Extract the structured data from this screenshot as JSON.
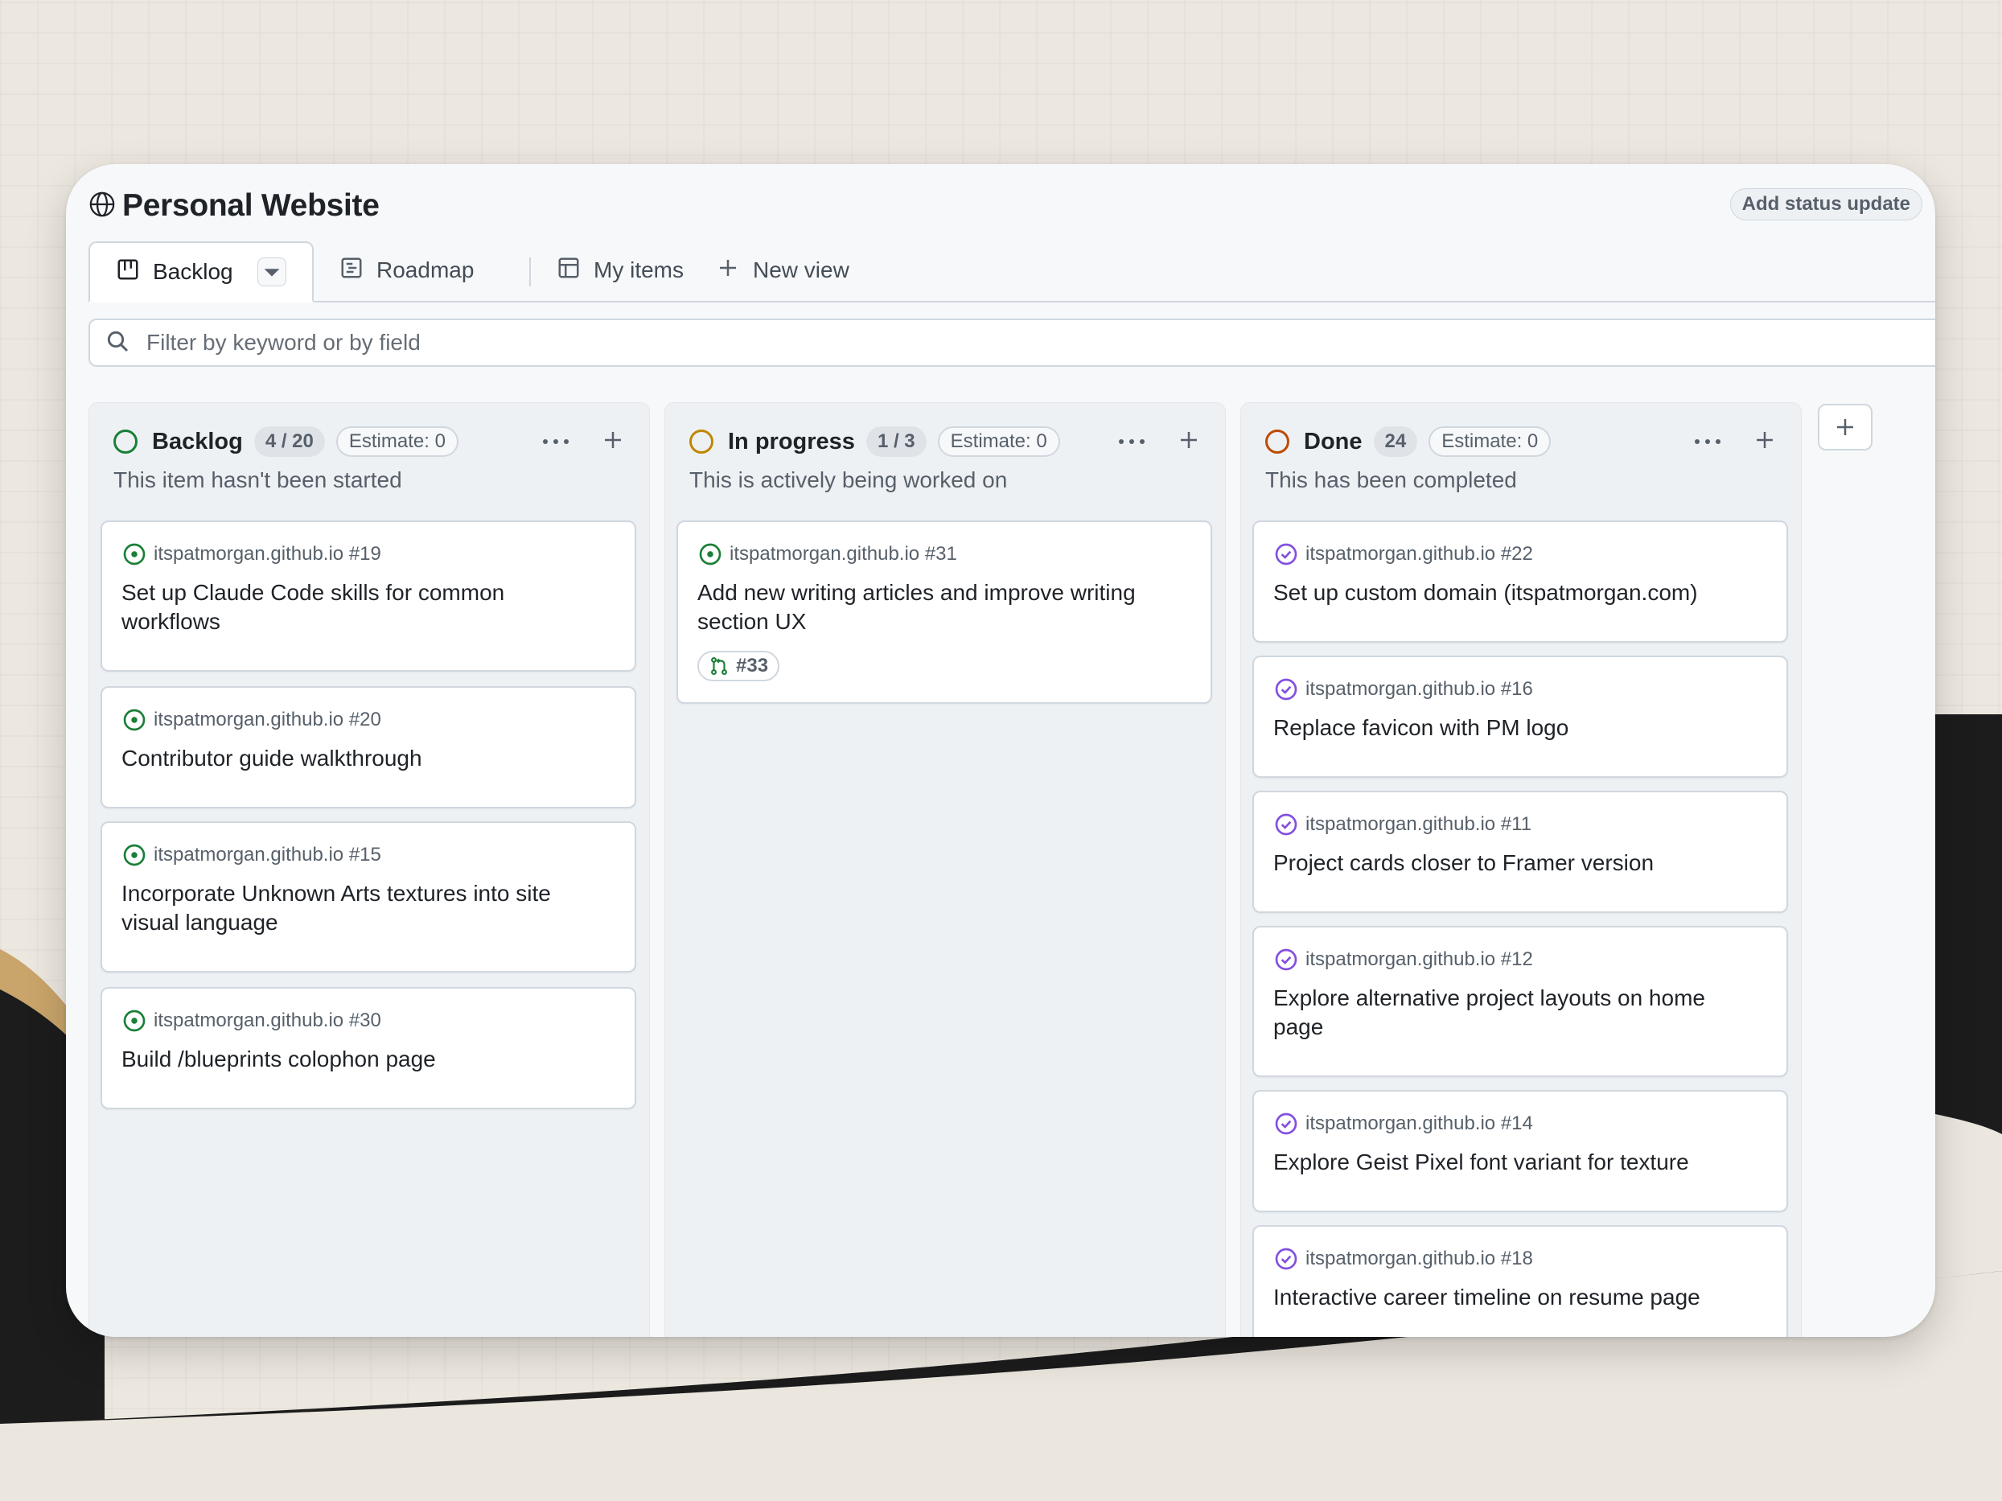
{
  "colors": {
    "open_green": "#1a7f37",
    "done_purple": "#8250df",
    "progress_yellow": "#bf8700",
    "done_column_orange": "#bc4c00",
    "text_primary": "#1f2328",
    "text_muted": "#57606a"
  },
  "header": {
    "title": "Personal Website",
    "title_icon": "globe-icon",
    "status_update_button": "Add status update"
  },
  "tabs": [
    {
      "label": "Backlog",
      "icon": "board-icon",
      "active": true
    },
    {
      "label": "Roadmap",
      "icon": "roadmap-icon",
      "active": false
    },
    {
      "label": "My items",
      "icon": "table-icon",
      "active": false
    },
    {
      "label": "New view",
      "icon": "plus-icon",
      "active": false
    }
  ],
  "filter": {
    "placeholder": "Filter by keyword or by field",
    "value": ""
  },
  "columns": [
    {
      "name": "Backlog",
      "count": "4 / 20",
      "estimate": "Estimate: 0",
      "description": "This item hasn't been started",
      "status_color": "#1a7f37",
      "cards": [
        {
          "ref": "itspatmorgan.github.io #19",
          "title": "Set up Claude Code skills for common workflows",
          "state": "open"
        },
        {
          "ref": "itspatmorgan.github.io #20",
          "title": "Contributor guide walkthrough",
          "state": "open"
        },
        {
          "ref": "itspatmorgan.github.io #15",
          "title": "Incorporate Unknown Arts textures into site visual language",
          "state": "open"
        },
        {
          "ref": "itspatmorgan.github.io #30",
          "title": "Build /blueprints colophon page",
          "state": "open"
        }
      ]
    },
    {
      "name": "In progress",
      "count": "1 / 3",
      "estimate": "Estimate: 0",
      "description": "This is actively being worked on",
      "status_color": "#bf8700",
      "cards": [
        {
          "ref": "itspatmorgan.github.io #31",
          "title": "Add new writing articles and improve writing section UX",
          "state": "open",
          "pr": "#33"
        }
      ]
    },
    {
      "name": "Done",
      "count": "24",
      "estimate": "Estimate: 0",
      "description": "This has been completed",
      "status_color": "#bc4c00",
      "cards": [
        {
          "ref": "itspatmorgan.github.io #22",
          "title": "Set up custom domain (itspatmorgan.com)",
          "state": "closed"
        },
        {
          "ref": "itspatmorgan.github.io #16",
          "title": "Replace favicon with PM logo",
          "state": "closed"
        },
        {
          "ref": "itspatmorgan.github.io #11",
          "title": "Project cards closer to Framer version",
          "state": "closed"
        },
        {
          "ref": "itspatmorgan.github.io #12",
          "title": "Explore alternative project layouts on home page",
          "state": "closed"
        },
        {
          "ref": "itspatmorgan.github.io #14",
          "title": "Explore Geist Pixel font variant for texture",
          "state": "closed"
        },
        {
          "ref": "itspatmorgan.github.io #18",
          "title": "Interactive career timeline on resume page",
          "state": "closed"
        }
      ]
    }
  ]
}
